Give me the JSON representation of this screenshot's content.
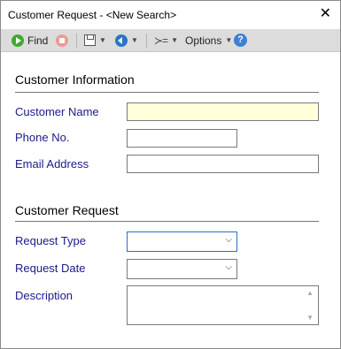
{
  "window": {
    "title": "Customer Request - <New Search>"
  },
  "toolbar": {
    "find_label": "Find",
    "options_label": "Options",
    "help_glyph": "?",
    "list_glyph": "≻="
  },
  "sections": {
    "customer_info": "Customer Information",
    "customer_request": "Customer Request"
  },
  "fields": {
    "customer_name": {
      "label": "Customer Name",
      "value": ""
    },
    "phone": {
      "label": "Phone No.",
      "value": ""
    },
    "email": {
      "label": "Email Address",
      "value": ""
    },
    "request_type": {
      "label": "Request Type",
      "value": ""
    },
    "request_date": {
      "label": "Request Date",
      "value": ""
    },
    "description": {
      "label": "Description",
      "value": ""
    }
  },
  "colors": {
    "label": "#1a1a8c",
    "highlight_field": "#ffffd9",
    "toolbar_bg": "#dcdcdc",
    "find_icon": "#3dab2c",
    "stop_icon": "#f09898",
    "help_icon": "#3c7fd6"
  },
  "icons": [
    "play-icon",
    "stop-icon",
    "save-icon",
    "back-icon",
    "list-icon",
    "help-icon",
    "close-icon",
    "chevron-down-icon"
  ]
}
